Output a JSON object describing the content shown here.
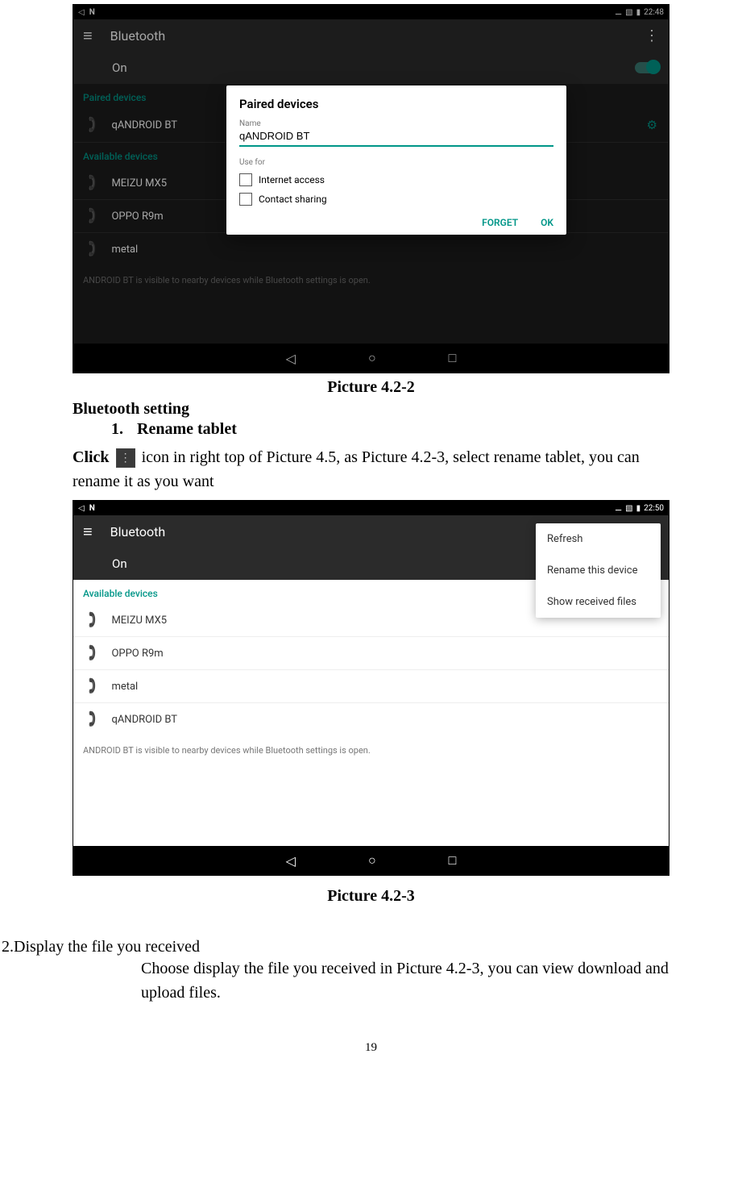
{
  "doc": {
    "caption1": "Picture 4.2-2",
    "heading1": "Bluetooth setting",
    "list1_num": "1.",
    "list1_text": "Rename tablet",
    "body1a": "Click",
    "body1b": "icon in right top of Picture 4.5, as Picture 4.2-3, select rename tablet, you can rename it as you want",
    "caption2": "Picture 4.2-3",
    "list2": "2.Display the file you received",
    "body2": "Choose display the file you received in Picture 4.2-3, you can view download and upload files.",
    "pagenum": "19"
  },
  "shot1": {
    "time": "22:48",
    "title": "Bluetooth",
    "toggle_label": "On",
    "paired_header": "Paired devices",
    "available_header": "Available devices",
    "paired": [
      "qANDROID BT"
    ],
    "available": [
      "MEIZU MX5",
      "OPPO R9m",
      "metal"
    ],
    "hint": "ANDROID BT is visible to nearby devices while Bluetooth settings is open.",
    "dialog": {
      "title": "Paired devices",
      "name_label": "Name",
      "name_value": "qANDROID BT",
      "usefor": "Use for",
      "opt1": "Internet access",
      "opt2": "Contact sharing",
      "forget": "FORGET",
      "ok": "OK"
    }
  },
  "shot2": {
    "time": "22:50",
    "title": "Bluetooth",
    "toggle_label": "On",
    "available_header": "Available devices",
    "available": [
      "MEIZU MX5",
      "OPPO R9m",
      "metal",
      "qANDROID BT"
    ],
    "hint": "ANDROID BT is visible to nearby devices while Bluetooth settings is open.",
    "menu": {
      "item1": "Refresh",
      "item2": "Rename this device",
      "item3": "Show received files"
    }
  }
}
